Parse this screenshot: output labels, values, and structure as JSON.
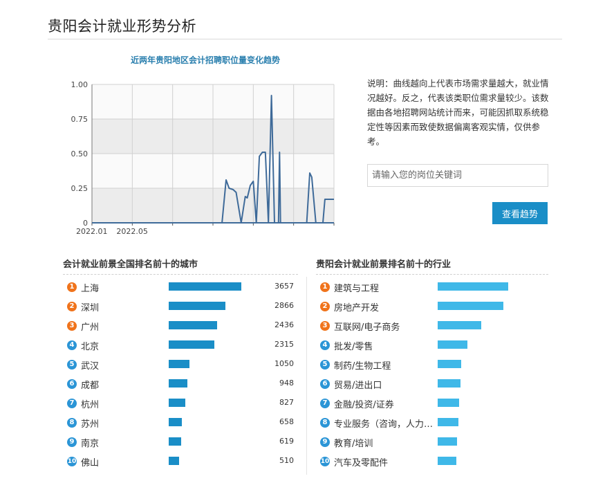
{
  "page": {
    "title": "贵阳会计就业形势分析"
  },
  "trend": {
    "title": "近两年贵阳地区会计招聘职位量变化趋势"
  },
  "chart_data": {
    "type": "line",
    "title": "近两年贵阳地区会计招聘职位量变化趋势",
    "xlabel": "",
    "ylabel": "",
    "ylim": [
      0,
      1
    ],
    "yticks": [
      "0",
      "0.25",
      "0.50",
      "0.75",
      "1.00"
    ],
    "yticks_values": [
      0,
      0.25,
      0.5,
      0.75,
      1
    ],
    "xtick_labels": [
      "2022.01",
      "2022.05"
    ],
    "x_months": 24,
    "grid": true,
    "color": "#3e6a99",
    "points": [
      [
        0,
        0
      ],
      [
        12.9,
        0
      ],
      [
        13.3,
        0.31
      ],
      [
        13.6,
        0.25
      ],
      [
        14.0,
        0.24
      ],
      [
        14.3,
        0.22
      ],
      [
        14.8,
        0
      ],
      [
        15.2,
        0.19
      ],
      [
        15.4,
        0.18
      ],
      [
        15.7,
        0.27
      ],
      [
        16.0,
        0.3
      ],
      [
        16.3,
        0
      ],
      [
        16.6,
        0.48
      ],
      [
        16.9,
        0.51
      ],
      [
        17.2,
        0.51
      ],
      [
        17.5,
        0
      ],
      [
        17.8,
        0.92
      ],
      [
        18.1,
        0
      ],
      [
        18.5,
        0
      ],
      [
        18.6,
        0.51
      ],
      [
        18.7,
        0
      ],
      [
        21.3,
        0
      ],
      [
        21.6,
        0.36
      ],
      [
        21.8,
        0.33
      ],
      [
        22.2,
        0
      ],
      [
        22.9,
        0
      ],
      [
        23.1,
        0.17
      ],
      [
        24,
        0.17
      ]
    ]
  },
  "info": {
    "note": "说明：曲线越向上代表市场需求量越大，就业情况越好。反之，代表该类职位需求量较少。该数据由各地招聘网站统计而来，可能因抓取系统稳定性等因素而致使数据偏离客观实情，仅供参考。",
    "search_placeholder": "请输入您的岗位关键词",
    "button_label": "查看趋势"
  },
  "cities": {
    "title": "会计就业前景全国排名前十的城市",
    "bar_color": "#1a8ec7",
    "items": [
      {
        "rank": "1",
        "name": "上海",
        "value": 3657
      },
      {
        "rank": "2",
        "name": "深圳",
        "value": 2866
      },
      {
        "rank": "3",
        "name": "广州",
        "value": 2436
      },
      {
        "rank": "4",
        "name": "北京",
        "value": 2315
      },
      {
        "rank": "5",
        "name": "武汉",
        "value": 1050
      },
      {
        "rank": "6",
        "name": "成都",
        "value": 948
      },
      {
        "rank": "7",
        "name": "杭州",
        "value": 827
      },
      {
        "rank": "8",
        "name": "苏州",
        "value": 658
      },
      {
        "rank": "9",
        "name": "南京",
        "value": 619
      },
      {
        "rank": "10",
        "name": "佛山",
        "value": 510
      }
    ]
  },
  "industries": {
    "title": "贵阳会计就业前景排名前十的行业",
    "bar_color": "#3fb8e8",
    "items": [
      {
        "rank": "1",
        "name": "建筑与工程",
        "share": 1.0
      },
      {
        "rank": "2",
        "name": "房地产开发",
        "share": 0.93
      },
      {
        "rank": "3",
        "name": "互联网/电子商务",
        "share": 0.62
      },
      {
        "rank": "4",
        "name": "批发/零售",
        "share": 0.42
      },
      {
        "rank": "5",
        "name": "制药/生物工程",
        "share": 0.33
      },
      {
        "rank": "6",
        "name": "贸易/进出口",
        "share": 0.32
      },
      {
        "rank": "7",
        "name": "金融/投资/证券",
        "share": 0.3
      },
      {
        "rank": "8",
        "name": "专业服务（咨询，人力…",
        "share": 0.29
      },
      {
        "rank": "9",
        "name": "教育/培训",
        "share": 0.27
      },
      {
        "rank": "10",
        "name": "汽车及零配件",
        "share": 0.26
      }
    ]
  },
  "rank_colors": {
    "top": "#f0731b",
    "rest": "#2b95d6"
  }
}
